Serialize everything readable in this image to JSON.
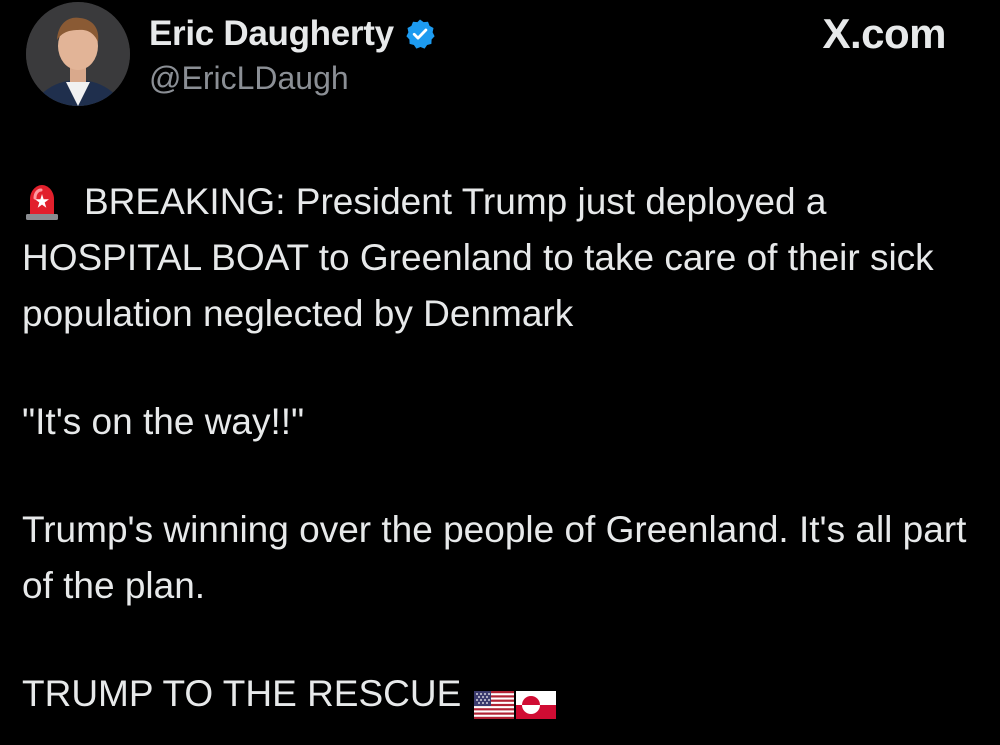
{
  "author": {
    "display_name": "Eric Daugherty",
    "handle": "@EricLDaugh",
    "verified": true,
    "avatar_icon": "profile-photo"
  },
  "source_label": "X.com",
  "tweet": {
    "breaking_icon": "police-siren-emoji",
    "paragraph_1": "BREAKING: President Trump just deployed a HOSPITAL BOAT to Greenland to take care of their sick population neglected by Denmark",
    "paragraph_2": "\"It's on the way!!\"",
    "paragraph_3": "Trump's winning over the people of Greenland. It's all part of the plan.",
    "paragraph_4": "TRUMP TO THE RESCUE",
    "trailing_icons": [
      "us-flag-emoji",
      "greenland-flag-emoji"
    ]
  },
  "colors": {
    "background": "#000000",
    "text": "#e7e9ea",
    "handle": "#8b8f95",
    "verified_badge": "#1d9bf0"
  }
}
